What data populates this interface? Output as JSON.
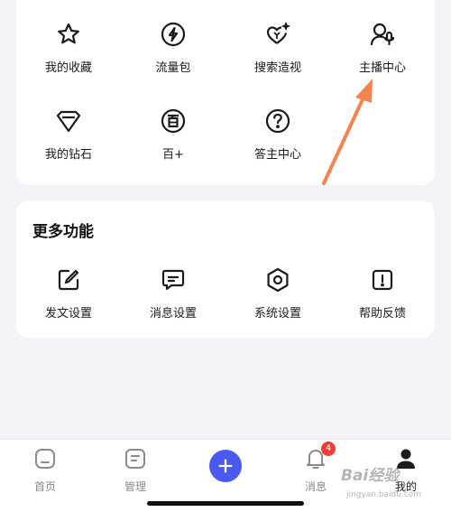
{
  "tools": {
    "items": [
      {
        "label": "我的收藏",
        "icon": "star-icon"
      },
      {
        "label": "流量包",
        "icon": "lightning-icon"
      },
      {
        "label": "搜索造视",
        "icon": "sparkle-heart-icon"
      },
      {
        "label": "主播中心",
        "icon": "user-mic-icon"
      },
      {
        "label": "我的钻石",
        "icon": "diamond-icon"
      },
      {
        "label": "百+",
        "icon": "hundred-icon"
      },
      {
        "label": "答主中心",
        "icon": "question-icon"
      }
    ]
  },
  "more": {
    "title": "更多功能",
    "items": [
      {
        "label": "发文设置",
        "icon": "edit-icon"
      },
      {
        "label": "消息设置",
        "icon": "message-icon"
      },
      {
        "label": "系统设置",
        "icon": "hexagon-settings-icon"
      },
      {
        "label": "帮助反馈",
        "icon": "exclamation-icon"
      }
    ]
  },
  "tabbar": {
    "home": "首页",
    "manage": "管理",
    "messages": "消息",
    "messages_badge": "4",
    "me": "我的"
  },
  "watermark": {
    "brand": "Bai经验",
    "url": "jingyan.baidu.com"
  },
  "colors": {
    "accent": "#4a5af0",
    "badge": "#f23b3b",
    "annotation_arrow": "#f4834f"
  }
}
